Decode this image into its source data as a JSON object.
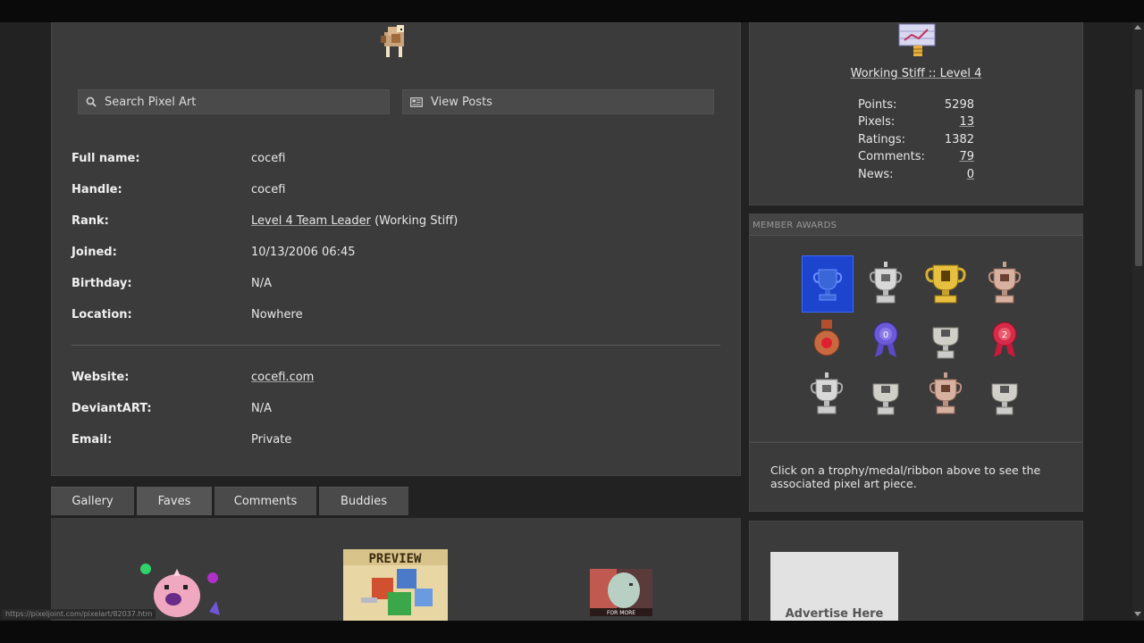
{
  "search": {
    "label": "Search Pixel Art"
  },
  "posts": {
    "label": "View Posts"
  },
  "profile": {
    "fullname_label": "Full name:",
    "fullname": "cocefi",
    "handle_label": "Handle:",
    "handle": "cocefi",
    "rank_label": "Rank:",
    "rank_link": "Level 4 Team Leader",
    "rank_suffix": "(Working Stiff)",
    "joined_label": "Joined:",
    "joined": "10/13/2006 06:45",
    "birthday_label": "Birthday:",
    "birthday": "N/A",
    "location_label": "Location:",
    "location": "Nowhere",
    "website_label": "Website:",
    "website": "cocefi.com",
    "deviantart_label": "DeviantART:",
    "deviantart": "N/A",
    "email_label": "Email:",
    "email": "Private"
  },
  "tabs": [
    {
      "label": "Gallery"
    },
    {
      "label": "Faves"
    },
    {
      "label": "Comments"
    },
    {
      "label": "Buddies"
    }
  ],
  "active_tab": "Faves",
  "stats": {
    "rank_title": "Working Stiff :: Level 4",
    "points_label": "Points:",
    "points": "5298",
    "pixels_label": "Pixels:",
    "pixels": "13",
    "ratings_label": "Ratings:",
    "ratings": "1382",
    "comments_label": "Comments:",
    "comments": "79",
    "news_label": "News:",
    "news": "0"
  },
  "awards": {
    "header": "MEMBER AWARDS",
    "note": "Click on a trophy/medal/ribbon above to see the associated pixel art piece.",
    "items": [
      {
        "icon": "trophy-icon",
        "selected": true
      },
      {
        "icon": "trophy-icon"
      },
      {
        "icon": "trophy-icon"
      },
      {
        "icon": "trophy-icon"
      },
      {
        "icon": "medal-icon"
      },
      {
        "icon": "ribbon-icon"
      },
      {
        "icon": "trophy-icon"
      },
      {
        "icon": "ribbon-icon"
      },
      {
        "icon": "trophy-icon"
      },
      {
        "icon": "trophy-icon"
      },
      {
        "icon": "trophy-icon"
      },
      {
        "icon": "trophy-icon"
      }
    ]
  },
  "gallery": {
    "preview_text": "PREVIEW",
    "for_more_text": "FOR MORE"
  },
  "ad": {
    "label": "Advertise Here"
  },
  "status_url": "https://pixeljoint.com/pixelart/82037.htm",
  "colors": {
    "background": "#222222",
    "panel": "#3b3b3b",
    "button": "#4a4a4a",
    "award_selected": "#1d44cc"
  }
}
